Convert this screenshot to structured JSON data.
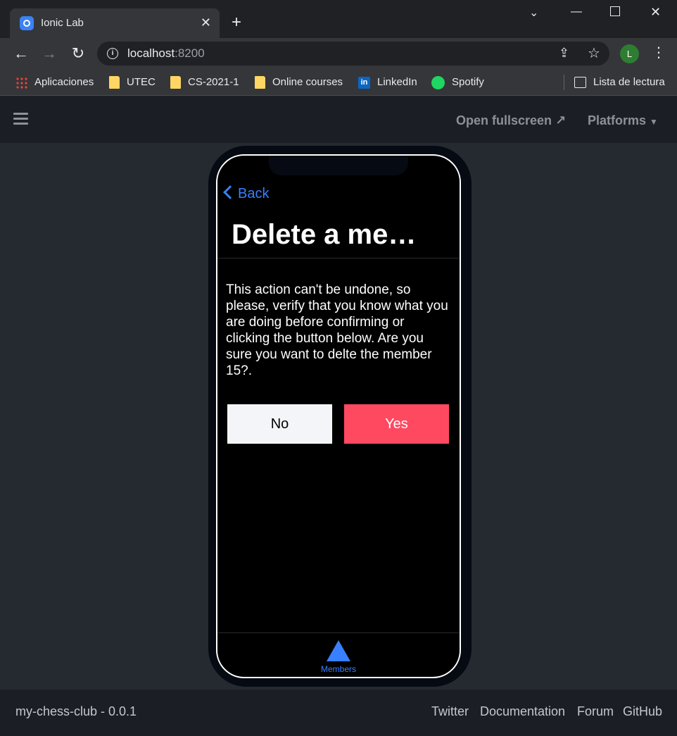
{
  "browser": {
    "tab_title": "Ionic Lab",
    "url_host": "localhost",
    "url_port": ":8200",
    "profile_initial": "L",
    "bookmarks": [
      "Aplicaciones",
      "UTEC",
      "CS-2021-1",
      "Online courses",
      "LinkedIn",
      "Spotify"
    ],
    "reading_list": "Lista de lectura"
  },
  "lab": {
    "open_fullscreen": "Open fullscreen",
    "platforms": "Platforms",
    "app_version": "my-chess-club - 0.0.1",
    "footer_links": [
      "Twitter",
      "Documentation",
      "Forum",
      "GitHub"
    ]
  },
  "app": {
    "back_label": "Back",
    "title": "Delete a me…",
    "message": "This action can't be undone, so please, verify that you know what you are doing before confirming or clicking the button below. Are you sure you want to delte the member 15?.",
    "no_label": "No",
    "yes_label": "Yes",
    "tab_label": "Members"
  },
  "colors": {
    "ionic_primary": "#3880ff",
    "danger": "#ff4961",
    "light": "#f4f5f8"
  }
}
